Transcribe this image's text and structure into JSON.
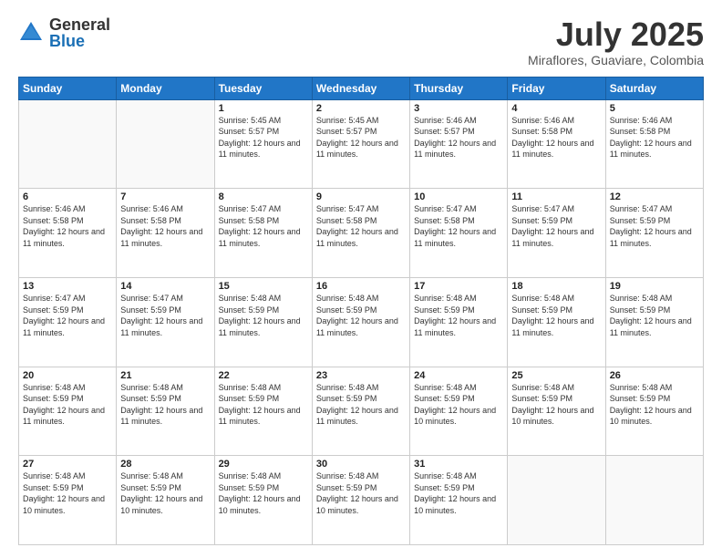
{
  "logo": {
    "general": "General",
    "blue": "Blue"
  },
  "header": {
    "month": "July 2025",
    "location": "Miraflores, Guaviare, Colombia"
  },
  "weekdays": [
    "Sunday",
    "Monday",
    "Tuesday",
    "Wednesday",
    "Thursday",
    "Friday",
    "Saturday"
  ],
  "weeks": [
    [
      {
        "day": "",
        "info": ""
      },
      {
        "day": "",
        "info": ""
      },
      {
        "day": "1",
        "info": "Sunrise: 5:45 AM\nSunset: 5:57 PM\nDaylight: 12 hours and 11 minutes."
      },
      {
        "day": "2",
        "info": "Sunrise: 5:45 AM\nSunset: 5:57 PM\nDaylight: 12 hours and 11 minutes."
      },
      {
        "day": "3",
        "info": "Sunrise: 5:46 AM\nSunset: 5:57 PM\nDaylight: 12 hours and 11 minutes."
      },
      {
        "day": "4",
        "info": "Sunrise: 5:46 AM\nSunset: 5:58 PM\nDaylight: 12 hours and 11 minutes."
      },
      {
        "day": "5",
        "info": "Sunrise: 5:46 AM\nSunset: 5:58 PM\nDaylight: 12 hours and 11 minutes."
      }
    ],
    [
      {
        "day": "6",
        "info": "Sunrise: 5:46 AM\nSunset: 5:58 PM\nDaylight: 12 hours and 11 minutes."
      },
      {
        "day": "7",
        "info": "Sunrise: 5:46 AM\nSunset: 5:58 PM\nDaylight: 12 hours and 11 minutes."
      },
      {
        "day": "8",
        "info": "Sunrise: 5:47 AM\nSunset: 5:58 PM\nDaylight: 12 hours and 11 minutes."
      },
      {
        "day": "9",
        "info": "Sunrise: 5:47 AM\nSunset: 5:58 PM\nDaylight: 12 hours and 11 minutes."
      },
      {
        "day": "10",
        "info": "Sunrise: 5:47 AM\nSunset: 5:58 PM\nDaylight: 12 hours and 11 minutes."
      },
      {
        "day": "11",
        "info": "Sunrise: 5:47 AM\nSunset: 5:59 PM\nDaylight: 12 hours and 11 minutes."
      },
      {
        "day": "12",
        "info": "Sunrise: 5:47 AM\nSunset: 5:59 PM\nDaylight: 12 hours and 11 minutes."
      }
    ],
    [
      {
        "day": "13",
        "info": "Sunrise: 5:47 AM\nSunset: 5:59 PM\nDaylight: 12 hours and 11 minutes."
      },
      {
        "day": "14",
        "info": "Sunrise: 5:47 AM\nSunset: 5:59 PM\nDaylight: 12 hours and 11 minutes."
      },
      {
        "day": "15",
        "info": "Sunrise: 5:48 AM\nSunset: 5:59 PM\nDaylight: 12 hours and 11 minutes."
      },
      {
        "day": "16",
        "info": "Sunrise: 5:48 AM\nSunset: 5:59 PM\nDaylight: 12 hours and 11 minutes."
      },
      {
        "day": "17",
        "info": "Sunrise: 5:48 AM\nSunset: 5:59 PM\nDaylight: 12 hours and 11 minutes."
      },
      {
        "day": "18",
        "info": "Sunrise: 5:48 AM\nSunset: 5:59 PM\nDaylight: 12 hours and 11 minutes."
      },
      {
        "day": "19",
        "info": "Sunrise: 5:48 AM\nSunset: 5:59 PM\nDaylight: 12 hours and 11 minutes."
      }
    ],
    [
      {
        "day": "20",
        "info": "Sunrise: 5:48 AM\nSunset: 5:59 PM\nDaylight: 12 hours and 11 minutes."
      },
      {
        "day": "21",
        "info": "Sunrise: 5:48 AM\nSunset: 5:59 PM\nDaylight: 12 hours and 11 minutes."
      },
      {
        "day": "22",
        "info": "Sunrise: 5:48 AM\nSunset: 5:59 PM\nDaylight: 12 hours and 11 minutes."
      },
      {
        "day": "23",
        "info": "Sunrise: 5:48 AM\nSunset: 5:59 PM\nDaylight: 12 hours and 11 minutes."
      },
      {
        "day": "24",
        "info": "Sunrise: 5:48 AM\nSunset: 5:59 PM\nDaylight: 12 hours and 10 minutes."
      },
      {
        "day": "25",
        "info": "Sunrise: 5:48 AM\nSunset: 5:59 PM\nDaylight: 12 hours and 10 minutes."
      },
      {
        "day": "26",
        "info": "Sunrise: 5:48 AM\nSunset: 5:59 PM\nDaylight: 12 hours and 10 minutes."
      }
    ],
    [
      {
        "day": "27",
        "info": "Sunrise: 5:48 AM\nSunset: 5:59 PM\nDaylight: 12 hours and 10 minutes."
      },
      {
        "day": "28",
        "info": "Sunrise: 5:48 AM\nSunset: 5:59 PM\nDaylight: 12 hours and 10 minutes."
      },
      {
        "day": "29",
        "info": "Sunrise: 5:48 AM\nSunset: 5:59 PM\nDaylight: 12 hours and 10 minutes."
      },
      {
        "day": "30",
        "info": "Sunrise: 5:48 AM\nSunset: 5:59 PM\nDaylight: 12 hours and 10 minutes."
      },
      {
        "day": "31",
        "info": "Sunrise: 5:48 AM\nSunset: 5:59 PM\nDaylight: 12 hours and 10 minutes."
      },
      {
        "day": "",
        "info": ""
      },
      {
        "day": "",
        "info": ""
      }
    ]
  ]
}
